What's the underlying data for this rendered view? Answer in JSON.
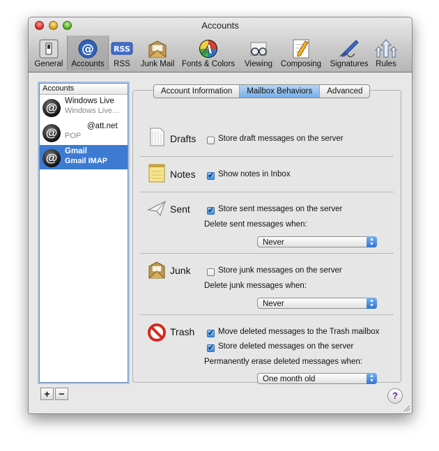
{
  "window": {
    "title": "Accounts"
  },
  "toolbar": {
    "items": [
      {
        "label": "General",
        "icon": "general-switch-icon"
      },
      {
        "label": "Accounts",
        "icon": "at-sign-icon",
        "selected": true
      },
      {
        "label": "RSS",
        "icon": "rss-icon"
      },
      {
        "label": "Junk Mail",
        "icon": "junk-envelope-icon"
      },
      {
        "label": "Fonts & Colors",
        "icon": "color-a-icon"
      },
      {
        "label": "Viewing",
        "icon": "glasses-icon"
      },
      {
        "label": "Composing",
        "icon": "pencil-paper-icon"
      },
      {
        "label": "Signatures",
        "icon": "pen-signature-icon"
      },
      {
        "label": "Rules",
        "icon": "rules-arrows-icon"
      }
    ]
  },
  "accounts": {
    "header": "Accounts",
    "items": [
      {
        "name": "Windows Live",
        "type": "Windows Live…"
      },
      {
        "name": "@att.net",
        "type": "POP"
      },
      {
        "name": "Gmail",
        "type": "Gmail IMAP",
        "selected": true
      }
    ],
    "add_label": "+",
    "remove_label": "−"
  },
  "tabs": [
    {
      "label": "Account Information"
    },
    {
      "label": "Mailbox Behaviors",
      "active": true
    },
    {
      "label": "Advanced"
    }
  ],
  "sections": {
    "drafts": {
      "title": "Drafts",
      "option": "Store draft messages on the server",
      "checked": false
    },
    "notes": {
      "title": "Notes",
      "option": "Show notes in Inbox",
      "checked": true
    },
    "sent": {
      "title": "Sent",
      "option": "Store sent messages on the server",
      "checked": true,
      "delete_label": "Delete sent messages when:",
      "delete_value": "Never"
    },
    "junk": {
      "title": "Junk",
      "option": "Store junk messages on the server",
      "checked": false,
      "delete_label": "Delete junk messages when:",
      "delete_value": "Never"
    },
    "trash": {
      "title": "Trash",
      "option1": "Move deleted messages to the Trash mailbox",
      "option1_checked": true,
      "option2": "Store deleted messages on the server",
      "option2_checked": true,
      "erase_label": "Permanently erase deleted messages when:",
      "erase_value": "One month old"
    }
  },
  "help_label": "?"
}
